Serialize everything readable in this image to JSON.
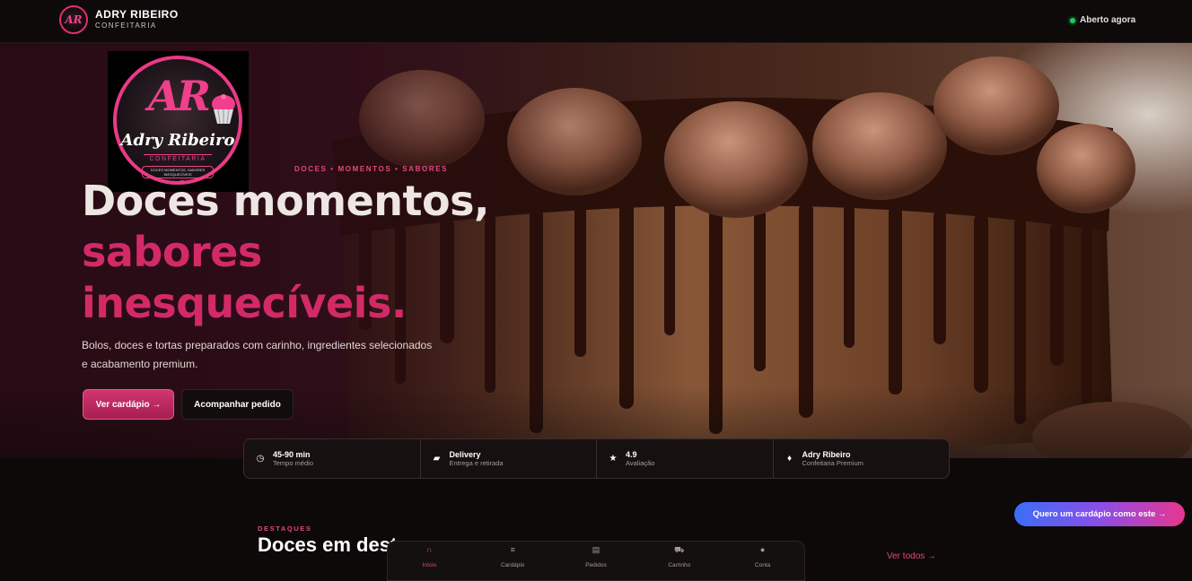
{
  "header": {
    "logo_initials": "AR",
    "brand_name": "ADRY RIBEIRO",
    "brand_sub": "CONFEITARIA",
    "status": "Aberto agora",
    "status_color": "#22c55e"
  },
  "hero": {
    "logo": {
      "monogram": "AR",
      "script": "Adry Ribeiro",
      "subtitle": "CONFEITARIA",
      "slogan": "DOCES MOMENTOS, SABORES INESQUECÍVEIS"
    },
    "eyebrow": "DOCES • MOMENTOS • SABORES",
    "headline_line1": "Doces momentos,",
    "headline_line2": "sabores",
    "headline_line3": "inesquecíveis.",
    "description": "Bolos, doces e tortas preparados com carinho, ingredientes selecionados e acabamento premium.",
    "primary_button": "Ver cardápio →",
    "secondary_button": "Acompanhar pedido"
  },
  "stats": [
    {
      "icon": "clock-icon",
      "title": "45-90 min",
      "subtitle": "Tempo médio"
    },
    {
      "icon": "delivery-icon",
      "title": "Delivery",
      "subtitle": "Entrega e retirada"
    },
    {
      "icon": "star-icon",
      "title": "4.9",
      "subtitle": "Avaliação"
    },
    {
      "icon": "diamond-icon",
      "title": "Adry Ribeiro",
      "subtitle": "Confeitaria Premium"
    }
  ],
  "highlights": {
    "eyebrow": "DESTAQUES",
    "title": "Doces em destaque",
    "see_all": "Ver todos →"
  },
  "bottom_nav": [
    {
      "icon": "home-icon",
      "label": "Início",
      "active": true
    },
    {
      "icon": "menu-icon",
      "label": "Cardápio",
      "active": false
    },
    {
      "icon": "orders-icon",
      "label": "Pedidos",
      "active": false
    },
    {
      "icon": "cart-icon",
      "label": "Carrinho",
      "active": false
    },
    {
      "icon": "account-icon",
      "label": "Conta",
      "active": false
    }
  ],
  "floating_cta": "Quero um cardápio como este →",
  "colors": {
    "accent": "#d32a67",
    "accent_light": "#e04a7e",
    "background": "#0d0909"
  }
}
